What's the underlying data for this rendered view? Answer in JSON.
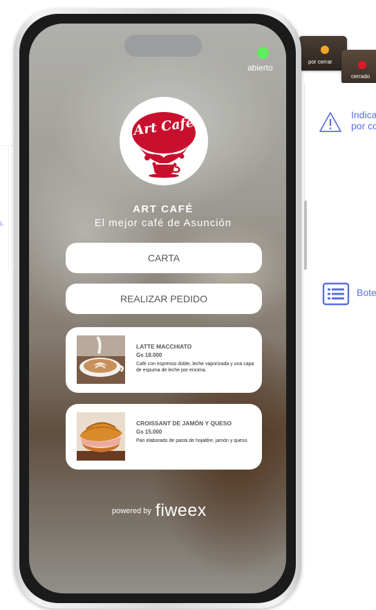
{
  "status": {
    "open_label": "abierto",
    "closing_label": "por cerrar",
    "closed_label": "cerrado",
    "colors": {
      "open": "#5cf05a",
      "closing": "#f5a623",
      "closed": "#e0192b"
    }
  },
  "brand": {
    "logo_text": "Art Cafe",
    "title": "ART CAFÉ",
    "subtitle": "El mejor café de Asunción"
  },
  "buttons": {
    "menu_label": "CARTA",
    "order_label": "REALIZAR PEDIDO"
  },
  "products": [
    {
      "name": "LATTE MACCHIATO",
      "price": "Gs 18.000",
      "description": "Café con espresso doble, leche vaporizada y una capa de espuma de leche por encima.",
      "image": "latte-art-cup"
    },
    {
      "name": "CROISSANT DE JAMÓN Y QUESO",
      "price": "Gs 15.000",
      "description": "Pan elaborado de pasta de hojaldre, jamón y queso.",
      "image": "croissant-sandwich"
    }
  ],
  "footer": {
    "powered_label": "powered by",
    "powered_brand": "fiweex"
  },
  "annotations": {
    "indicator_text_line1": "Indica",
    "indicator_text_line2": "por co",
    "button_text": "Bote",
    "left_fragment": "s.",
    "icons": [
      "warning-icon",
      "list-icon"
    ],
    "accent": "#5a6ee0"
  }
}
